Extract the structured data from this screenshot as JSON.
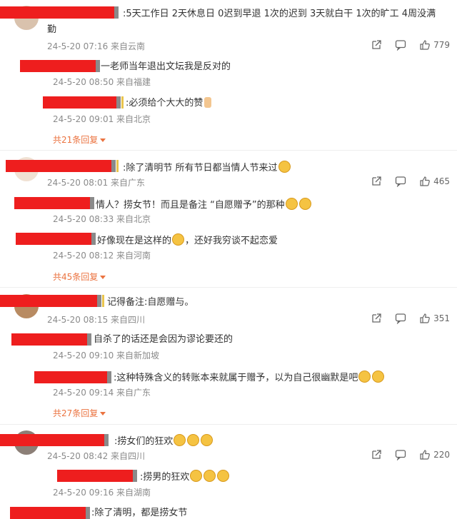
{
  "comments": [
    {
      "text": ":5天工作日 2天休息日 0迟到早退 1次的迟到 3天就白干 1次的旷工 4周没满",
      "text_wrap": "勤",
      "meta": "24-5-20 07:16 来自云南",
      "likes": "779",
      "replies": [
        {
          "text": "一老师当年退出文坛我是反对的",
          "meta": "24-5-20 08:50 来自福建"
        },
        {
          "text": ":必须给个大大的赞",
          "meta": "24-5-20 09:01 来自北京"
        }
      ],
      "more": "共21条回复"
    },
    {
      "text": ":除了清明节 所有节日都当情人节来过",
      "meta": "24-5-20 08:01 来自广东",
      "likes": "465",
      "replies": [
        {
          "text": "情人？捞女节！而且是备注 “自愿赠予”的那种",
          "meta": "24-5-20 08:33 来自北京"
        },
        {
          "text": "好像现在是这样的",
          "text2": "，还好我穷谈不起恋爱",
          "meta": "24-5-20 08:12 来自河南"
        }
      ],
      "more": "共45条回复"
    },
    {
      "text": "记得备注:自愿赠与。",
      "meta": "24-5-20 08:15 来自四川",
      "likes": "351",
      "replies": [
        {
          "text": "自杀了的话还是会因为谬论要还的",
          "meta": "24-5-20 09:10 来自新加坡"
        },
        {
          "text": ":这种特殊含义的转账本来就属于赠予，以为自己很幽默是吧",
          "meta": "24-5-20 09:14 来自广东"
        }
      ],
      "more": "共27条回复"
    },
    {
      "text": ":捞女们的狂欢",
      "meta": "24-5-20 08:42 来自四川",
      "likes": "220",
      "replies": [
        {
          "text": ":捞男的狂欢",
          "meta": "24-5-20 09:16 来自湖南"
        }
      ]
    },
    {
      "text": ":除了清明，都是捞女节"
    }
  ],
  "icons": {
    "share": "share-icon",
    "comment": "comment-icon",
    "like": "like-icon"
  }
}
